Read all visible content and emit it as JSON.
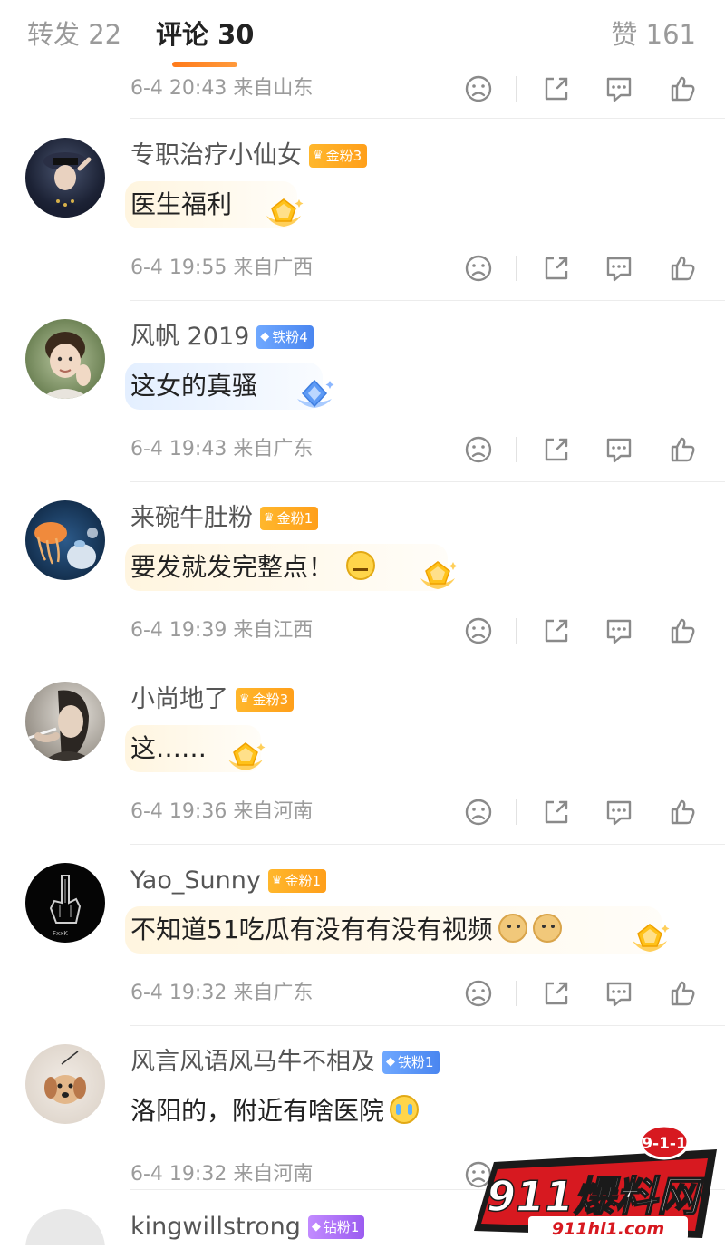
{
  "tabs": {
    "repost": "转发 22",
    "comments": "评论 30",
    "likes": "赞 161"
  },
  "partial_row": {
    "time": "6-4 20:43 来自山东"
  },
  "comments": [
    {
      "username": "专职治疗小仙女",
      "badge": "金粉3",
      "badge_type": "gold",
      "text": "医生福利",
      "time": "6-4 19:55 来自广西"
    },
    {
      "username": "风帆 2019",
      "badge": "铁粉4",
      "badge_type": "iron",
      "text": "这女的真骚",
      "time": "6-4 19:43 来自广东"
    },
    {
      "username": "来碗牛肚粉",
      "badge": "金粉1",
      "badge_type": "gold",
      "text": "要发就发完整点！",
      "time": "6-4 19:39 来自江西"
    },
    {
      "username": "小尚地了",
      "badge": "金粉3",
      "badge_type": "gold",
      "text": "这……",
      "time": "6-4 19:36 来自河南"
    },
    {
      "username": "Yao_Sunny",
      "badge": "金粉1",
      "badge_type": "gold",
      "text": "不知道51吃瓜有没有有没有视频",
      "time": "6-4 19:32 来自广东"
    },
    {
      "username": "风言风语风马牛不相及",
      "badge": "铁粉1",
      "badge_type": "iron",
      "text": "洛阳的，附近有啥医院",
      "time": "6-4 19:32 来自河南"
    },
    {
      "username": "kingwillstrong",
      "badge": "钻粉1",
      "badge_type": "diamond"
    }
  ],
  "watermark": {
    "badge": "9-1-1",
    "title": "911爆料网",
    "url": "911hl1.com"
  },
  "colors": {
    "accent": "#ff8200",
    "gold_badge": "#ffad22",
    "iron_badge": "#5a92f5",
    "diamond_badge": "#a96cf5",
    "watermark_red": "#d71920"
  },
  "icons": [
    "dislike-icon",
    "share-icon",
    "comment-icon",
    "like-icon"
  ]
}
